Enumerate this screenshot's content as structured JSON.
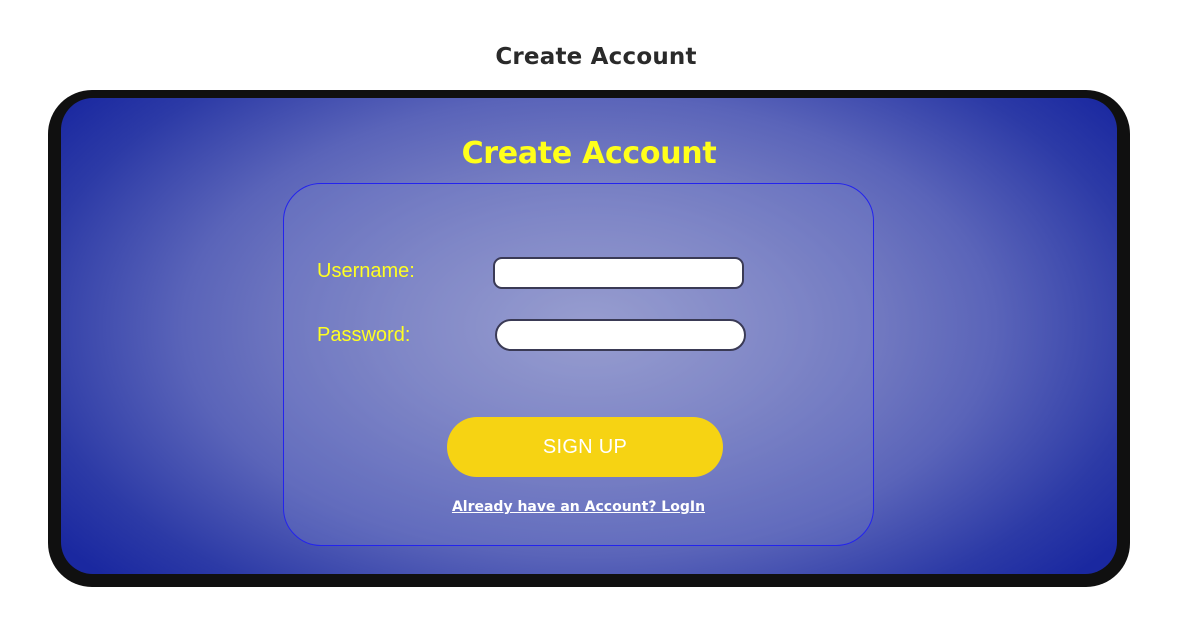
{
  "page": {
    "title": "Create Account"
  },
  "app": {
    "title": "Create Account"
  },
  "form": {
    "username_label": "Username:",
    "username_value": "",
    "password_label": "Password:",
    "password_value": "",
    "signup_label": "SIGN UP",
    "login_link": "Already have an Account? LogIn"
  },
  "colors": {
    "accent_yellow": "#ffff1a",
    "button_yellow": "#f6d313",
    "background_blue": "#1a28a0",
    "card_border": "#2323ee"
  }
}
